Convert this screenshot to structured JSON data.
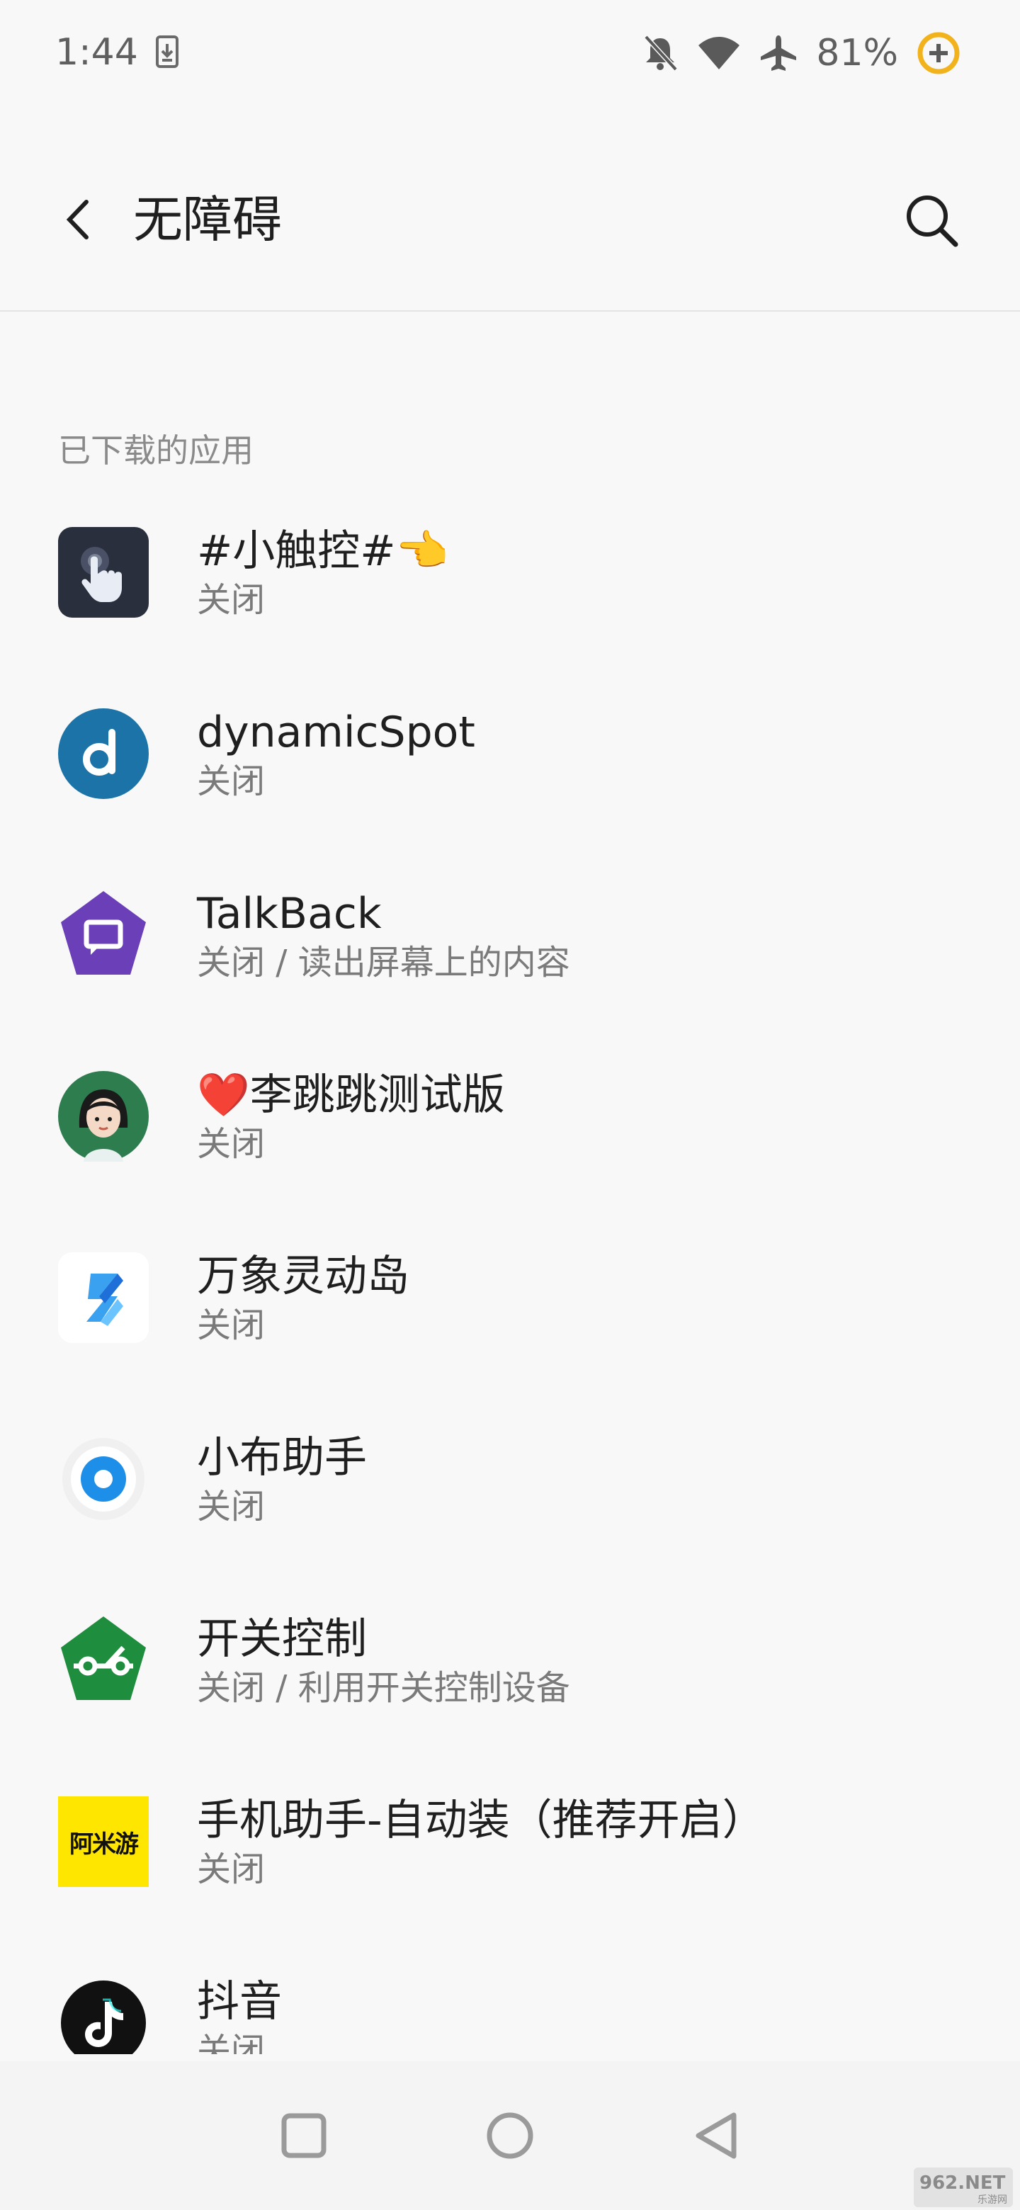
{
  "status_bar": {
    "time": "1:44",
    "battery": "81%",
    "icons": [
      "download-icon",
      "bell-off-icon",
      "wifi-icon",
      "airplane-icon",
      "battery-saver-icon"
    ]
  },
  "toolbar": {
    "title": "无障碍",
    "back_icon": "back-arrow-icon",
    "search_icon": "search-icon"
  },
  "section": {
    "title": "已下载的应用"
  },
  "apps": [
    {
      "title": "#小触控#👈",
      "summary": "关闭",
      "icon": "touch-hand-icon"
    },
    {
      "title": "dynamicSpot",
      "summary": "关闭",
      "icon": "dynamicspot-icon"
    },
    {
      "title": "TalkBack",
      "summary": "关闭 / 读出屏幕上的内容",
      "icon": "talkback-icon"
    },
    {
      "title": "❤️李跳跳测试版",
      "summary": "关闭",
      "icon": "avatar-girl-icon"
    },
    {
      "title": "万象灵动岛",
      "summary": "关闭",
      "icon": "wanxiang-icon"
    },
    {
      "title": "小布助手",
      "summary": "关闭",
      "icon": "xiaobu-icon"
    },
    {
      "title": "开关控制",
      "summary": "关闭 / 利用开关控制设备",
      "icon": "switch-access-icon"
    },
    {
      "title": "手机助手-自动装（推荐开启）",
      "summary": "关闭",
      "icon": "amiyou-icon",
      "icon_text": "阿米游"
    },
    {
      "title": "抖音",
      "summary": "关闭",
      "icon": "douyin-icon"
    }
  ],
  "nav_bar": {
    "icons": [
      "recents-icon",
      "home-icon",
      "back-icon"
    ]
  },
  "watermark": {
    "text": "962.NET",
    "subtext": "乐游网"
  },
  "colors": {
    "background": "#f8f8f8",
    "title_text": "#1f1f1f",
    "summary_text": "#7a7a7a",
    "section_text": "#8a8a8a",
    "talkback_purple": "#6b3fb8",
    "switch_green": "#1e8e3e",
    "dynamicspot_blue": "#1b73a8",
    "amiyou_yellow": "#ffe600"
  }
}
